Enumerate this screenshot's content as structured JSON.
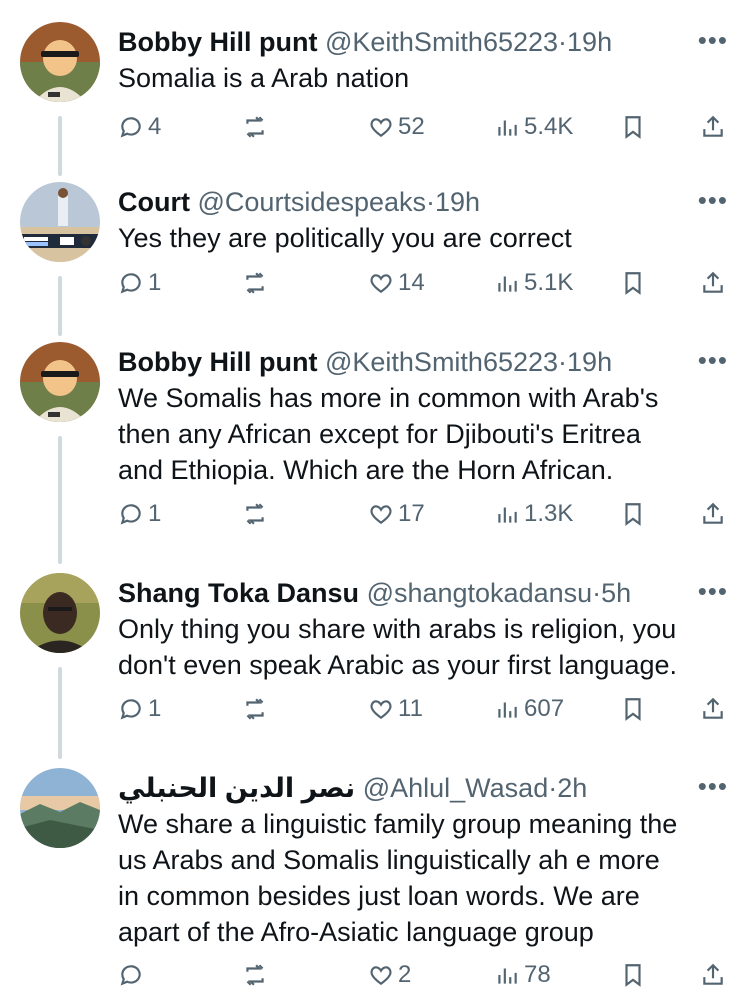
{
  "tweets": [
    {
      "name": "Bobby Hill punt",
      "handle": "@KeithSmith65223",
      "separator": "·",
      "time": "19h",
      "text": "Somalia is a Arab nation",
      "replies": "4",
      "retweets": "",
      "likes": "52",
      "views": "5.4K",
      "avatar_icon": "cartoon-avatar"
    },
    {
      "name": "Court",
      "handle": "@Courtsidespeaks",
      "separator": "·",
      "time": "19h",
      "text": "Yes they are politically you are correct",
      "replies": "1",
      "retweets": "",
      "likes": "14",
      "views": "5.1K",
      "avatar_icon": "basketball-broadcast-avatar"
    },
    {
      "name": "Bobby Hill punt",
      "handle": "@KeithSmith65223",
      "separator": "·",
      "time": "19h",
      "text": "We Somalis has more in common with Arab's\nthen any African except for Djibouti's Eritrea\nand Ethiopia. Which are the Horn African.",
      "replies": "1",
      "retweets": "",
      "likes": "17",
      "views": "1.3K",
      "avatar_icon": "cartoon-avatar"
    },
    {
      "name": "Shang Toka Dansu",
      "handle": "@shangtokadansu",
      "separator": "·",
      "time": "5h",
      "text": "Only thing you share with arabs is religion, you\ndon't even speak Arabic as your first language.",
      "replies": "1",
      "retweets": "",
      "likes": "11",
      "views": "607",
      "avatar_icon": "photo-avatar"
    },
    {
      "name": "نصر الدين الحنبلي",
      "handle": "@Ahlul_Wasad",
      "separator": "·",
      "time": "2h",
      "text": "We share a linguistic family group meaning the\nus Arabs and Somalis linguistically ah e more\nin common besides just loan words. We are\napart of the Afro-Asiatic language group",
      "replies": "",
      "retweets": "",
      "likes": "2",
      "views": "78",
      "avatar_icon": "landscape-avatar"
    }
  ],
  "more_label": "•••",
  "colors": {
    "text": "#0f1419",
    "muted": "#536471",
    "thread": "#cfd9de"
  }
}
